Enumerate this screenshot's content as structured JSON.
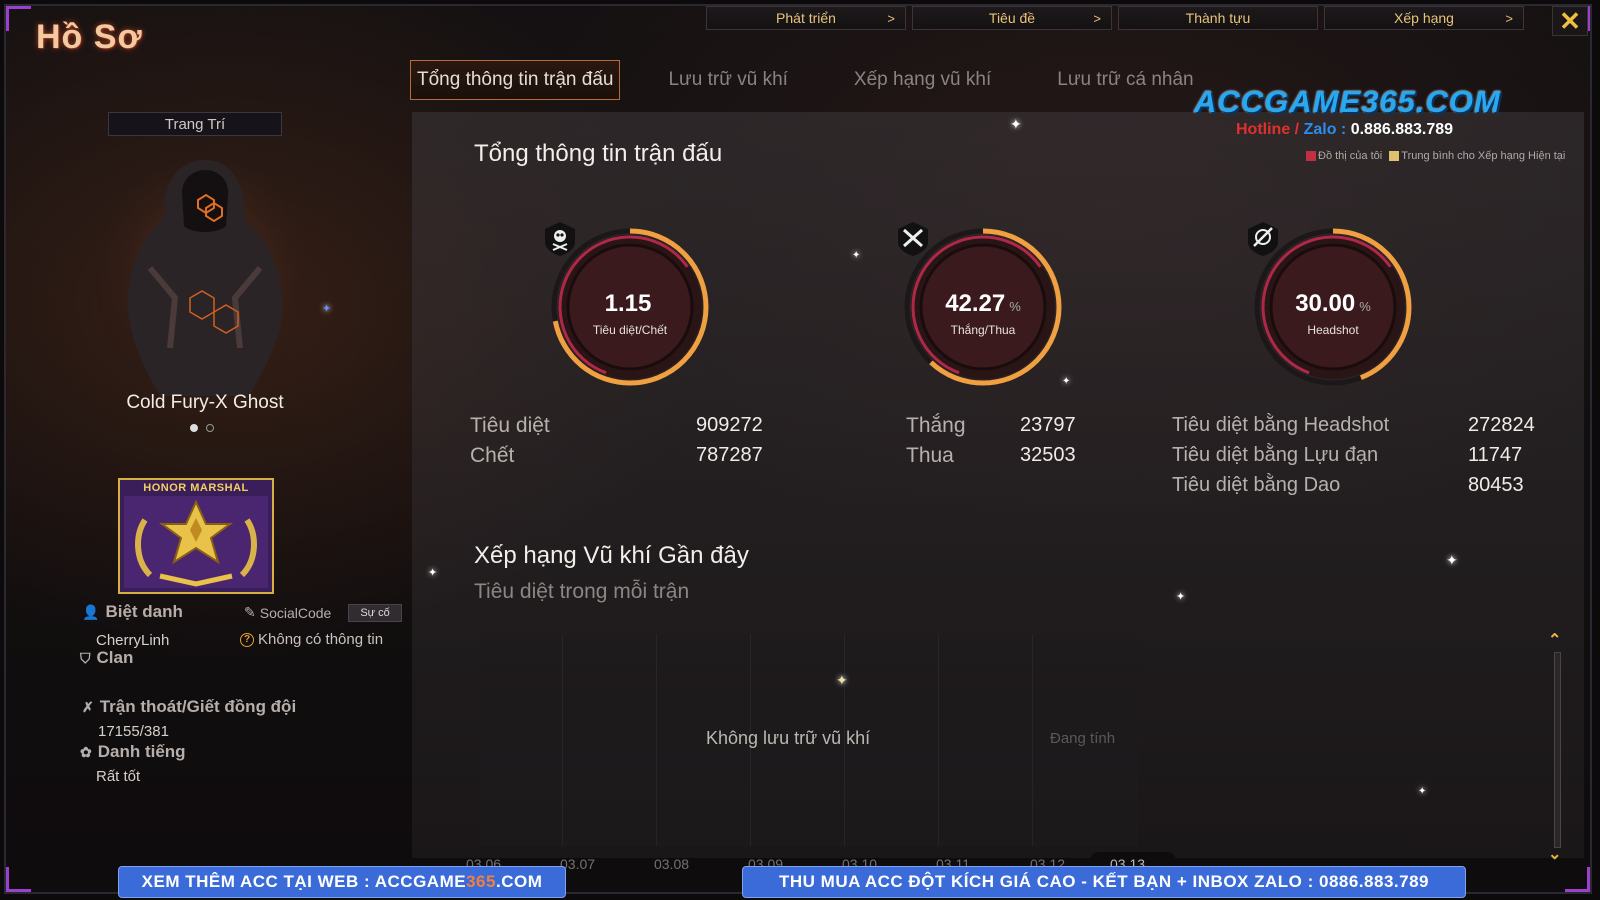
{
  "page_title": "Hồ Sơ",
  "top_nav": [
    {
      "label": "Phát triển",
      "chevron": ">"
    },
    {
      "label": "Tiêu đề",
      "chevron": ">"
    },
    {
      "label": "Thành tựu",
      "chevron": ""
    },
    {
      "label": "Xếp hạng",
      "chevron": ">"
    }
  ],
  "close_label": "✕",
  "tabs": [
    "Tổng thông tin trận đấu",
    "Lưu trữ vũ khí",
    "Xếp hạng vũ khí",
    "Lưu trữ cá nhân"
  ],
  "watermark": {
    "site": "ACCGAME365.COM",
    "hotline_label": "Hotline",
    "slash": "/",
    "zalo_label": "Zalo",
    "colon": ":",
    "phone": "0.886.883.789"
  },
  "profile": {
    "decor_button": "Trang Trí",
    "character_name": "Cold Fury-X Ghost",
    "badge_text": "HONOR MARSHAL",
    "nickname_label": "Biệt danh",
    "nickname": "CherryLinh",
    "social_label": "SocialCode",
    "report_button": "Sự cố",
    "social_value": "Không có thông tin",
    "clan_label": "Clan",
    "desert_label": "Trận thoát/Giết đồng đội",
    "desert_value": "17155/381",
    "reputation_label": "Danh tiếng",
    "reputation_value": "Rất tốt"
  },
  "summary": {
    "title": "Tổng thông tin trận đấu",
    "legend_mine": "Đồ thị của tôi",
    "legend_avg": "Trung bình cho Xếp hạng Hiện tại",
    "gauges": [
      {
        "value": "1.15",
        "unit": "",
        "label": "Tiêu diệt/Chết",
        "fill": 0.72,
        "icon": "skull-icon"
      },
      {
        "value": "42.27",
        "unit": "%",
        "label": "Thắng/Thua",
        "fill": 0.62,
        "icon": "crossed-guns-icon"
      },
      {
        "value": "30.00",
        "unit": "%",
        "label": "Headshot",
        "fill": 0.44,
        "icon": "crosshair-icon"
      }
    ],
    "stats": {
      "kills_label": "Tiêu diệt",
      "kills": "909272",
      "deaths_label": "Chết",
      "deaths": "787287",
      "wins_label": "Thắng",
      "wins": "23797",
      "losses_label": "Thua",
      "losses": "32503",
      "hs_label": "Tiêu diệt bằng Headshot",
      "hs": "272824",
      "grenade_label": "Tiêu diệt bằng Lựu đạn",
      "grenade": "11747",
      "knife_label": "Tiêu diệt bằng Dao",
      "knife": "80453"
    }
  },
  "recent": {
    "title": "Xếp hạng Vũ khí Gần đây",
    "subtitle": "Tiêu diệt trong mỗi trận",
    "empty": "Không lưu trữ vũ khí",
    "calculating": "Đang tính",
    "x_ticks": [
      "03.06",
      "03.07",
      "03.08",
      "03.09",
      "03.10",
      "03.11",
      "03.12",
      "03.13"
    ]
  },
  "banners": {
    "left_prefix": "XEM THÊM ACC TẠI WEB : ACCGAME",
    "left_hl": "365",
    "left_suffix": ".COM",
    "right": "THU MUA ACC ĐỘT KÍCH GIÁ CAO - KẾT BẠN + INBOX ZALO : 0886.883.789"
  },
  "colors": {
    "accent": "#e8c27a",
    "gauge_arc": "#f0a040",
    "gauge_arc_inner": "#b02848",
    "banner": "#3b6bd8",
    "watermark": "#27a8f0"
  }
}
